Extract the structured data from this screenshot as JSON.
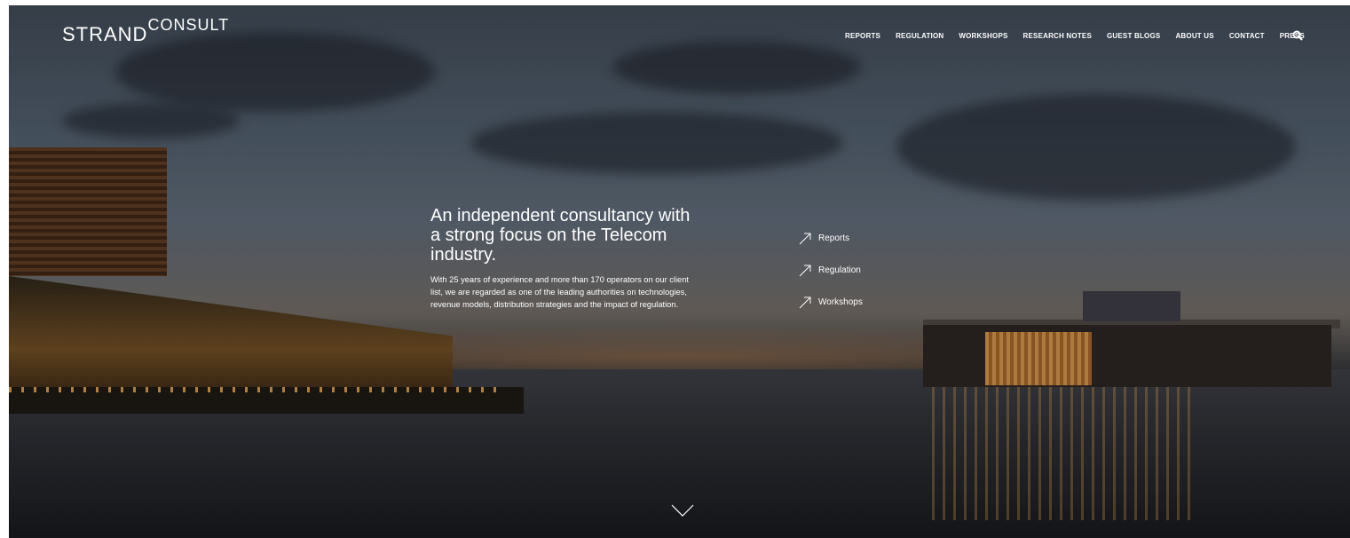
{
  "brand": {
    "strand": "STRAND",
    "consult": "CONSULT"
  },
  "nav": {
    "items": [
      "REPORTS",
      "REGULATION",
      "WORKSHOPS",
      "RESEARCH NOTES",
      "GUEST BLOGS",
      "ABOUT US",
      "CONTACT",
      "PRESS"
    ],
    "search_icon": "search-icon"
  },
  "hero": {
    "headline": "An independent consultancy with a strong focus on the Telecom industry.",
    "body": "With 25 years of experience and more than 170 operators on our client list, we are regarded as one of the leading authorities on technologies, revenue models, distribution strategies and the impact of regulation."
  },
  "quick_links": [
    "Reports",
    "Regulation",
    "Workshops"
  ],
  "scroll_icon": "chevron-down-icon"
}
